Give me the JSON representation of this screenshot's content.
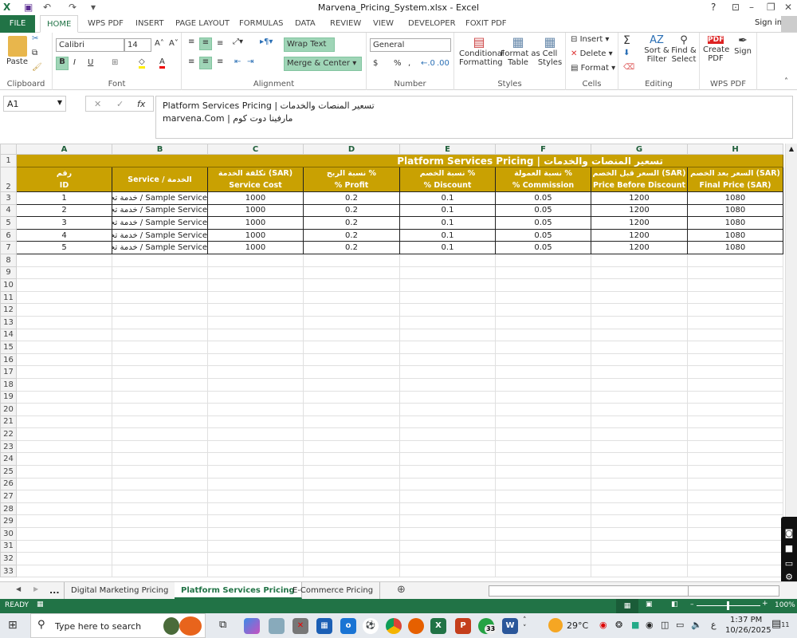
{
  "window": {
    "title": "Marvena_Pricing_System.xlsx - Excel",
    "help": "?",
    "sign_in": "Sign in"
  },
  "ribbon_tabs": [
    "FILE",
    "HOME",
    "WPS PDF",
    "INSERT",
    "PAGE LAYOUT",
    "FORMULAS",
    "DATA",
    "REVIEW",
    "VIEW",
    "DEVELOPER",
    "FOXIT PDF"
  ],
  "ribbon": {
    "clipboard": {
      "label": "Clipboard",
      "paste": "Paste"
    },
    "font": {
      "label": "Font",
      "name": "Calibri",
      "size": "14",
      "bold": "B",
      "italic": "I",
      "underline": "U"
    },
    "alignment": {
      "label": "Alignment",
      "wrap": "Wrap Text",
      "merge": "Merge & Center"
    },
    "number": {
      "label": "Number",
      "format": "General",
      "currency": "$",
      "percent": "%",
      "comma": ","
    },
    "styles": {
      "label": "Styles",
      "conditional": "Conditional",
      "conditional2": "Formatting",
      "format_table": "Format as",
      "format_table2": "Table",
      "cell_styles": "Cell",
      "cell_styles2": "Styles"
    },
    "cells": {
      "label": "Cells",
      "insert": "Insert",
      "delete": "Delete",
      "format": "Format"
    },
    "editing": {
      "label": "Editing",
      "sort": "Sort &",
      "sort2": "Filter",
      "find": "Find &",
      "find2": "Select"
    },
    "wps": {
      "label": "WPS PDF",
      "create": "Create",
      "create2": "PDF",
      "sign": "Sign"
    }
  },
  "formula_bar": {
    "name_box": "A1",
    "fx": "fx",
    "line1": "Platform Services Pricing | تسعير المنصات والخدمات",
    "line2": "marvena.Com | مارفينا دوت كوم"
  },
  "columns": [
    "A",
    "B",
    "C",
    "D",
    "E",
    "F",
    "G",
    "H"
  ],
  "sheet_title": "Platform Services Pricing | تسعير المنصات والخدمات",
  "headers": [
    [
      "رقم",
      "ID"
    ],
    [
      "Service / الخدمة",
      ""
    ],
    [
      "تكلفة الخدمة (SAR)",
      "Service Cost"
    ],
    [
      "نسبة الربح %",
      "% Profit"
    ],
    [
      "نسبة الخصم %",
      "% Discount"
    ],
    [
      "نسبة العمولة %",
      "% Commission"
    ],
    [
      "السعر قبل الخصم (SAR)",
      "Price Before Discount"
    ],
    [
      "السعر بعد الخصم (SAR)",
      "Final Price (SAR)"
    ]
  ],
  "rows": [
    [
      "1",
      "Sample Service / خدمة تجريبية",
      "1000",
      "0.2",
      "0.1",
      "0.05",
      "1200",
      "1080"
    ],
    [
      "2",
      "Sample Service / خدمة تجريبية",
      "1000",
      "0.2",
      "0.1",
      "0.05",
      "1200",
      "1080"
    ],
    [
      "3",
      "Sample Service / خدمة تجريبية",
      "1000",
      "0.2",
      "0.1",
      "0.05",
      "1200",
      "1080"
    ],
    [
      "4",
      "Sample Service / خدمة تجريبية",
      "1000",
      "0.2",
      "0.1",
      "0.05",
      "1200",
      "1080"
    ],
    [
      "5",
      "Sample Service / خدمة تجريبية",
      "1000",
      "0.2",
      "0.1",
      "0.05",
      "1200",
      "1080"
    ]
  ],
  "last_row": 33,
  "sheet_tabs": {
    "more": "...",
    "tabs": [
      "Digital Marketing Pricing",
      "Platform Services Pricing",
      "E-Commerce Pricing"
    ],
    "active": 1
  },
  "status": {
    "ready": "READY",
    "zoom": "100%"
  },
  "taskbar": {
    "search": "Type here to search",
    "weather": "29°C",
    "time": "1:37 PM",
    "date": "10/26/2025",
    "whatsapp_badge": "33",
    "notif": "11",
    "lang": "ع"
  },
  "colors": {
    "excel_green": "#217346",
    "header_gold": "#c9a102"
  }
}
